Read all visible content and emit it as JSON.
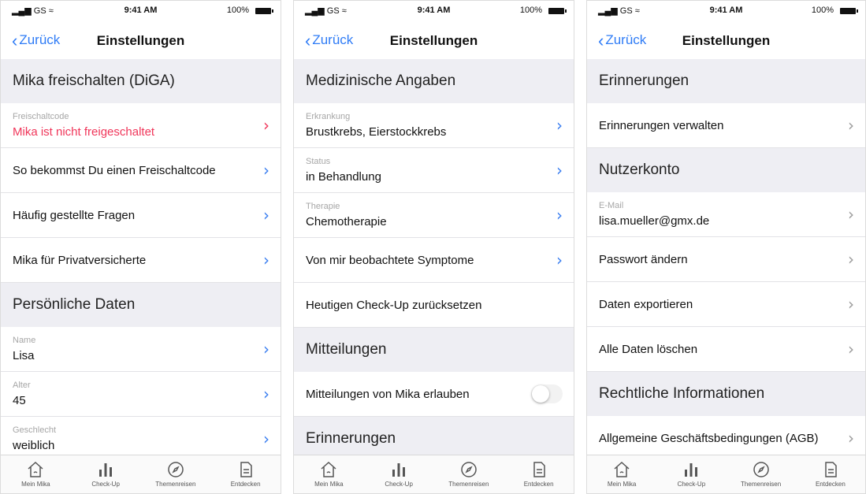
{
  "status": {
    "carrier": "GS",
    "time": "9:41 AM",
    "battery": "100%"
  },
  "nav": {
    "back_label": "Zurück",
    "title": "Einstellungen"
  },
  "tabs": [
    "Mein Mika",
    "Check-Up",
    "Themenreisen",
    "Entdecken"
  ],
  "screen1": {
    "section_diga": "Mika freischalten (DiGA)",
    "code_label": "Freischaltcode",
    "code_value": "Mika ist nicht freigeschaltet",
    "get_code": "So bekommst Du einen Freischaltcode",
    "faq": "Häufig gestellte Fragen",
    "private": "Mika für Privatversicherte",
    "section_personal": "Persönliche Daten",
    "name_label": "Name",
    "name_value": "Lisa",
    "age_label": "Alter",
    "age_value": "45",
    "gender_label": "Geschlecht",
    "gender_value": "weiblich"
  },
  "screen2": {
    "section_medical": "Medizinische Angaben",
    "disease_label": "Erkrankung",
    "disease_value": "Brustkrebs, Eierstockkrebs",
    "status_label": "Status",
    "status_value": "in Behandlung",
    "therapy_label": "Therapie",
    "therapy_value": "Chemotherapie",
    "symptoms": "Von mir beobachtete Symptome",
    "reset_checkup": "Heutigen Check-Up zurücksetzen",
    "section_messages": "Mitteilungen",
    "allow_messages": "Mitteilungen von Mika erlauben",
    "allow_messages_enabled": false,
    "section_reminders": "Erinnerungen"
  },
  "screen3": {
    "section_reminders": "Erinnerungen",
    "manage_reminders": "Erinnerungen verwalten",
    "section_account": "Nutzerkonto",
    "email_label": "E-Mail",
    "email_value": "lisa.mueller@gmx.de",
    "change_password": "Passwort ändern",
    "export_data": "Daten exportieren",
    "delete_data": "Alle Daten löschen",
    "section_legal": "Rechtliche Informationen",
    "terms": "Allgemeine Geschäftsbedingungen (AGB)"
  },
  "colors": {
    "accent": "#2f7cf6",
    "alert": "#f0365a",
    "section_bg": "#eeeef3"
  }
}
